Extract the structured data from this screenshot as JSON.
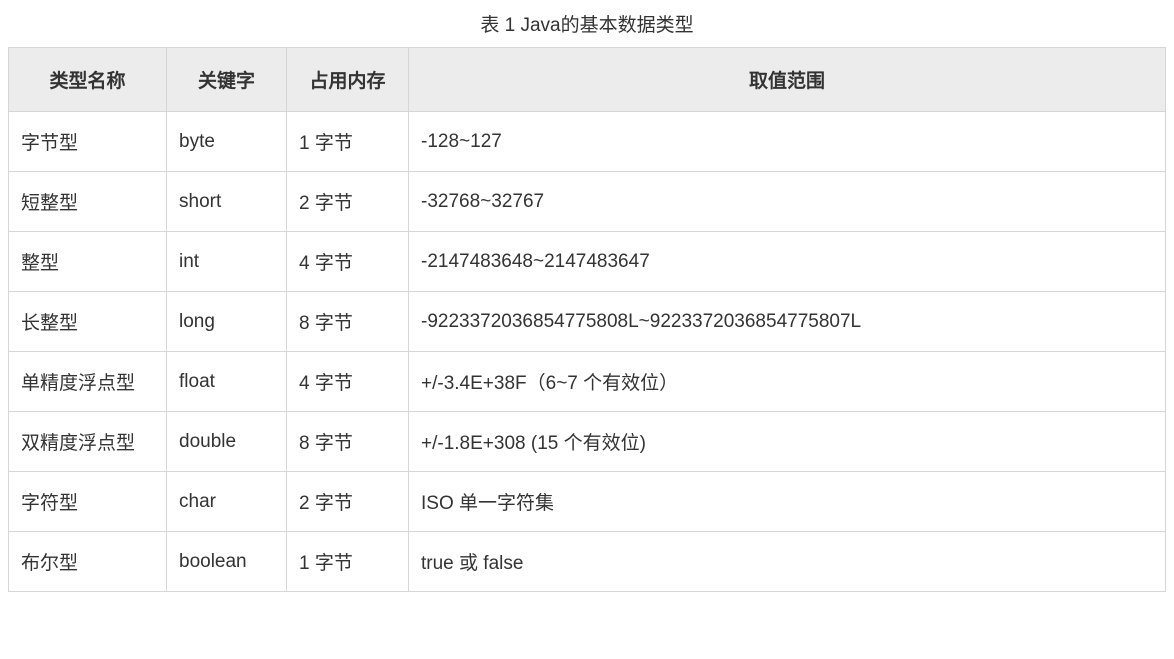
{
  "caption": "表 1 Java的基本数据类型",
  "headers": {
    "name": "类型名称",
    "keyword": "关键字",
    "memory": "占用内存",
    "range": "取值范围"
  },
  "rows": [
    {
      "name": "字节型",
      "keyword": "byte",
      "memory": "1 字节",
      "range": "-128~127"
    },
    {
      "name": "短整型",
      "keyword": "short",
      "memory": "2 字节",
      "range": "-32768~32767"
    },
    {
      "name": "整型",
      "keyword": "int",
      "memory": "4 字节",
      "range": "-2147483648~2147483647"
    },
    {
      "name": "长整型",
      "keyword": "long",
      "memory": "8 字节",
      "range": "-9223372036854775808L~9223372036854775807L"
    },
    {
      "name": "单精度浮点型",
      "keyword": "float",
      "memory": "4 字节",
      "range": "+/-3.4E+38F（6~7 个有效位）"
    },
    {
      "name": "双精度浮点型",
      "keyword": "double",
      "memory": "8 字节",
      "range": "+/-1.8E+308 (15 个有效位)"
    },
    {
      "name": "字符型",
      "keyword": "char",
      "memory": "2 字节",
      "range": "ISO 单一字符集"
    },
    {
      "name": "布尔型",
      "keyword": "boolean",
      "memory": "1 字节",
      "range": "true 或 false"
    }
  ]
}
